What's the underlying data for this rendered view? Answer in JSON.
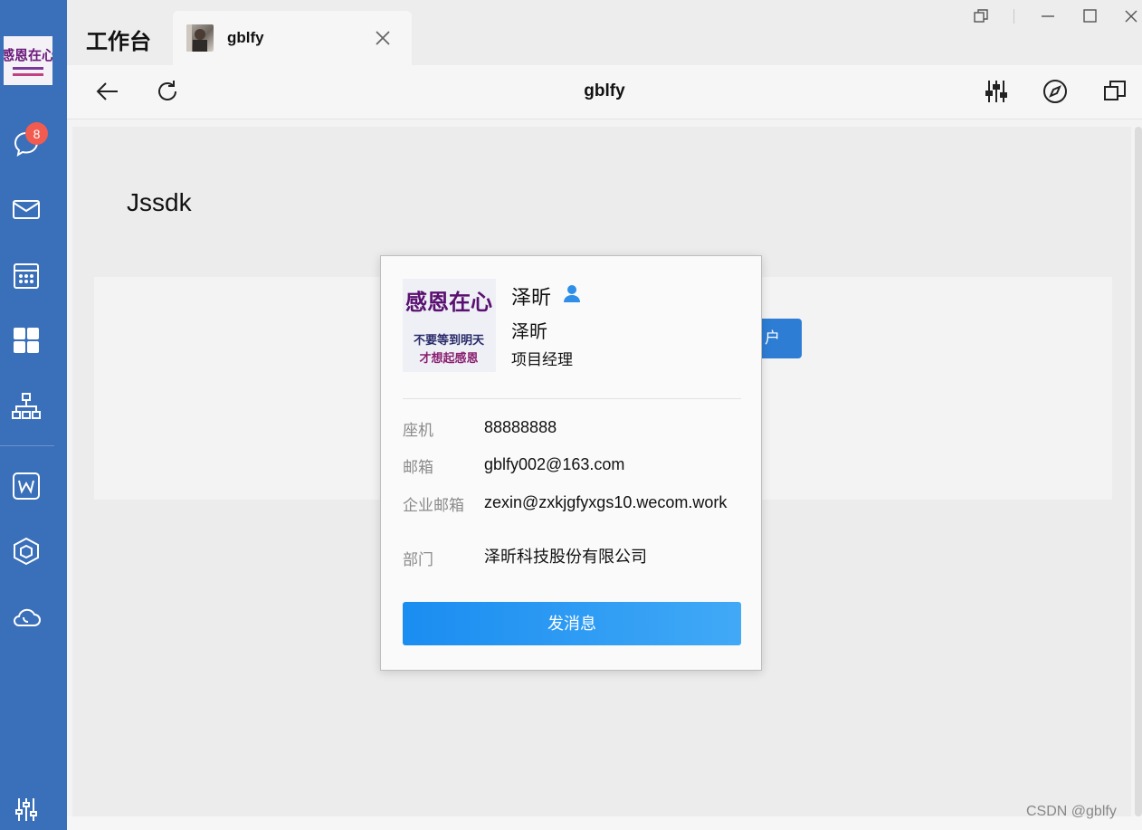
{
  "sidebar": {
    "avatar_text": "感恩在心",
    "message_badge": "8",
    "icons": [
      "chat-icon",
      "mail-icon",
      "calendar-icon",
      "workbench-icon",
      "org-chart-icon",
      "word-doc-icon",
      "cube-icon",
      "cloud-phone-icon",
      "settings-sliders-icon"
    ]
  },
  "tabs": {
    "home_label": "工作台",
    "active_tab_title": "gblfy"
  },
  "navbar": {
    "title": "gblfy"
  },
  "page": {
    "heading": "Jssdk",
    "button_partial_label": "户"
  },
  "card": {
    "avatar_caption_top": "感恩在心",
    "avatar_caption_line1": "不要等到明天",
    "avatar_caption_line2": "才想起感恩",
    "name": "泽昕",
    "alias": "泽昕",
    "position": "项目经理",
    "rows": [
      {
        "label": "座机",
        "value": "88888888"
      },
      {
        "label": "邮箱",
        "value": "gblfy002@163.com"
      },
      {
        "label": "企业邮箱",
        "value": "zexin@zxkjgfyxgs10.wecom.work"
      },
      {
        "label": "部门",
        "value": "泽昕科技股份有限公司"
      }
    ],
    "send_button": "发消息"
  },
  "watermark": "CSDN @gblfy",
  "colors": {
    "sidebar": "#3a6fba",
    "badge": "#f25b4f",
    "primary_button": "#2e7dd5",
    "send_button_start": "#1a8df1",
    "send_button_end": "#41a9f6"
  }
}
